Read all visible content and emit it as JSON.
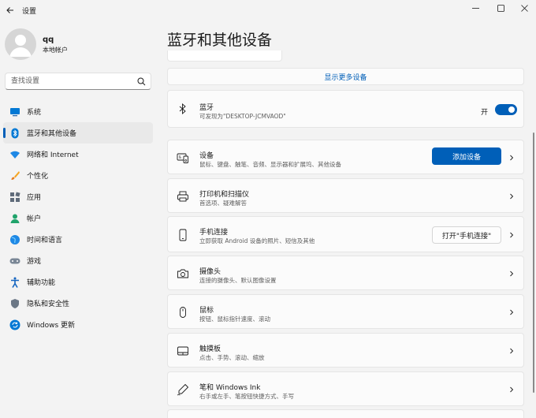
{
  "window": {
    "title": "设置"
  },
  "user": {
    "name": "qq",
    "account_type": "本地帐户"
  },
  "search": {
    "placeholder": "查找设置"
  },
  "sidebar": {
    "items": [
      {
        "label": "系统",
        "icon": "monitor-icon"
      },
      {
        "label": "蓝牙和其他设备",
        "icon": "bluetooth-icon"
      },
      {
        "label": "网络和 Internet",
        "icon": "wifi-icon"
      },
      {
        "label": "个性化",
        "icon": "brush-icon"
      },
      {
        "label": "应用",
        "icon": "apps-icon"
      },
      {
        "label": "帐户",
        "icon": "person-icon"
      },
      {
        "label": "时间和语言",
        "icon": "globe-icon"
      },
      {
        "label": "游戏",
        "icon": "gamepad-icon"
      },
      {
        "label": "辅助功能",
        "icon": "accessibility-icon"
      },
      {
        "label": "隐私和安全性",
        "icon": "shield-icon"
      },
      {
        "label": "Windows 更新",
        "icon": "update-icon"
      }
    ]
  },
  "main": {
    "title": "蓝牙和其他设备",
    "show_more": "显示更多设备",
    "bluetooth": {
      "title": "蓝牙",
      "subtitle": "可发现为\"DESKTOP-JCMVAOD\"",
      "toggle_label": "开"
    },
    "devices": {
      "title": "设备",
      "subtitle": "鼠标、键盘、触笔、音频、显示器和扩展坞、其他设备",
      "button": "添加设备"
    },
    "printers": {
      "title": "打印机和扫描仪",
      "subtitle": "首选项、疑难解答"
    },
    "phone": {
      "title": "手机连接",
      "subtitle": "立即获取 Android 设备的照片、短信及其他",
      "button": "打开\"手机连接\""
    },
    "camera": {
      "title": "摄像头",
      "subtitle": "连接的摄像头、默认图像设置"
    },
    "mouse": {
      "title": "鼠标",
      "subtitle": "按钮、鼠标指针速度、滚动"
    },
    "touchpad": {
      "title": "触摸板",
      "subtitle": "点击、手势、滚动、缩放"
    },
    "pen": {
      "title": "笔和 Windows Ink",
      "subtitle": "右手或左手、笔按钮快捷方式、手写"
    }
  },
  "colors": {
    "accent": "#005fb8",
    "background": "#f3f3f3",
    "card": "#fbfbfb"
  }
}
